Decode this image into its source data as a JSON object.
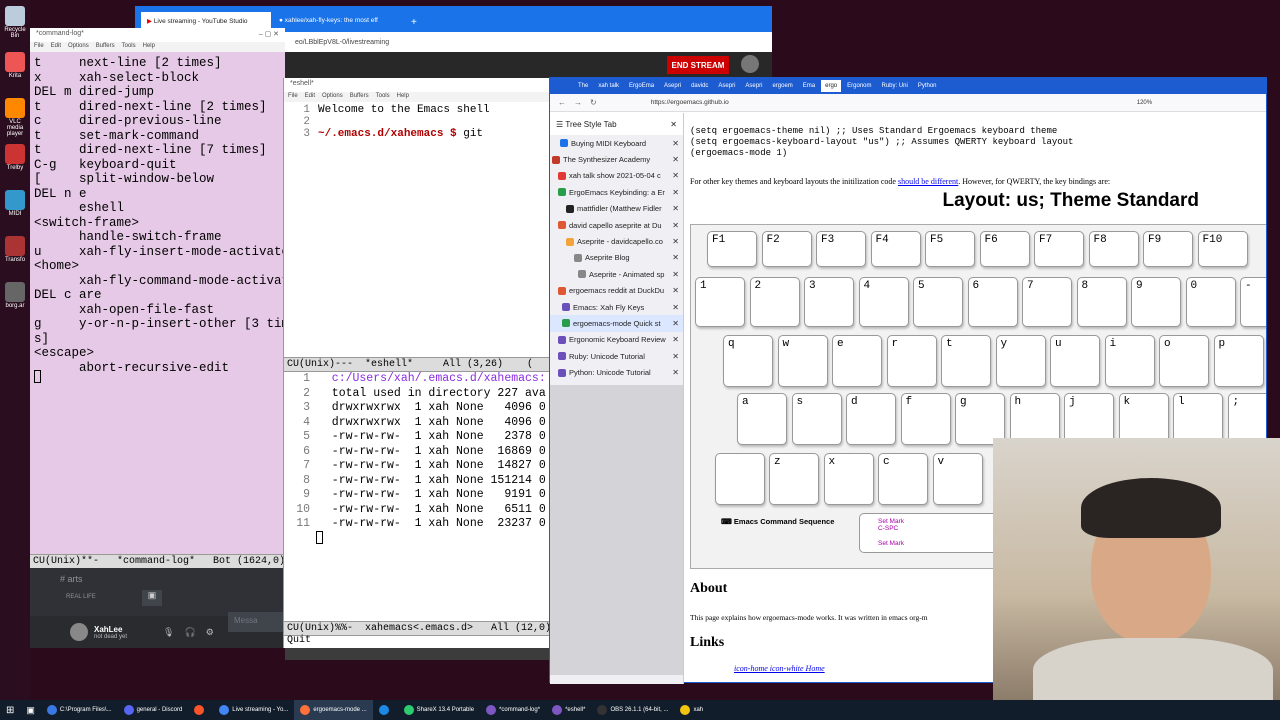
{
  "desktop": {
    "icons": [
      "Recycle Bin",
      "Krita",
      "VLC media player",
      "Trelby",
      "MIDI",
      "Transfo",
      "borg.ar"
    ]
  },
  "youtube_window": {
    "tabs": [
      {
        "label": "Live streaming - YouTube Studio"
      },
      {
        "label": "xahlee/xah-fly-keys: the most eff"
      }
    ],
    "url": "eo/LBblEpV8L-0/livestreaming",
    "end_stream": "END STREAM"
  },
  "cmdlog": {
    "title": "*command-log*",
    "menu": [
      "File",
      "Edit",
      "Options",
      "Buffers",
      "Tools",
      "Help"
    ],
    "lines": [
      "t     next-line [2 times]",
      "x     xah-select-block",
      "DEL m dired-jump",
      "t     dired-next-line [2 times]",
      "c     dired-previous-line",
      "t     set-mark-command",
      "t     dired-next-line [7 times]",
      "C-g   keyboard-quit",
      "[     split-window-below",
      "DEL n e",
      "      eshell",
      "<switch-frame>",
      "      handle-switch-frame",
      "u     xah-fly-insert-mode-activate",
      "<home>",
      "      xah-fly-command-mode-activate",
      "DEL c are",
      "      xah-open-file-fast",
      "g     y-or-n-p-insert-other [3 time",
      "s]",
      "<escape>",
      "      abort-recursive-edit"
    ],
    "modeline": "CU(Unix)**-   *command-log*   Bot (1624,0)"
  },
  "discord": {
    "channel": "arts",
    "category": "REAL LIFE",
    "user": "XahLee",
    "status": "not dead yet",
    "placeholder": "Messa"
  },
  "eshell": {
    "title": "*eshell*",
    "menu": [
      "File",
      "Edit",
      "Options",
      "Buffers",
      "Tools",
      "Help"
    ],
    "lines": [
      {
        "n": "1",
        "text": "Welcome to the Emacs shell"
      },
      {
        "n": "2",
        "text": ""
      },
      {
        "n": "3",
        "prompt": "~/.emacs.d/xahemacs $ ",
        "text": "git "
      }
    ],
    "modeline1": "CU(Unix)---  *eshell*     All (3,26)    (",
    "dired": [
      {
        "n": "1",
        "text": "  c:/Users/xah/.emacs.d/xahemacs:"
      },
      {
        "n": "2",
        "text": "  total used in directory 227 ava"
      },
      {
        "n": "3",
        "text": "  drwxrwxrwx  1 xah None   4096 0"
      },
      {
        "n": "4",
        "text": "  drwxrwxrwx  1 xah None   4096 0"
      },
      {
        "n": "5",
        "text": "  -rw-rw-rw-  1 xah None   2378 0"
      },
      {
        "n": "6",
        "text": "  -rw-rw-rw-  1 xah None  16869 0"
      },
      {
        "n": "7",
        "text": "  -rw-rw-rw-  1 xah None  14827 0"
      },
      {
        "n": "8",
        "text": "  -rw-rw-rw-  1 xah None 151214 0"
      },
      {
        "n": "9",
        "text": "  -rw-rw-rw-  1 xah None   9191 0"
      },
      {
        "n": "10",
        "text": "  -rw-rw-rw-  1 xah None   6511 0"
      },
      {
        "n": "11",
        "text": "  -rw-rw-rw-  1 xah None  23237 0"
      }
    ],
    "modeline2": "CU(Unix)%%-  xahemacs<.emacs.d>   All (12,0)",
    "minibuffer": "Quit"
  },
  "firefox": {
    "tabs": [
      "The",
      "xah talk",
      "ErgoEma",
      "Asepri",
      "davidc",
      "Asepri",
      "Asepri",
      "ergoem",
      "Ema",
      "ergo",
      "Ergonom",
      "Ruby: Uni",
      "Python"
    ],
    "url": "https://ergoemacs.github.io",
    "zoom": "120%",
    "sidebar_title": "Tree Style Tab",
    "tree": [
      {
        "label": "Buying MIDI Keyboard",
        "color": "#1a73e8"
      },
      {
        "label": "The Synthesizer Academy",
        "color": "#c0392b"
      },
      {
        "label": "xah talk show 2021-05-04 c",
        "color": "#e53935"
      },
      {
        "label": "ErgoEmacs Keybinding: a Er",
        "color": "#2a9d4a"
      },
      {
        "label": "mattfidler (Matthew Fidler",
        "color": "#222222"
      },
      {
        "label": "david capello aseprite at Du",
        "color": "#de5833"
      },
      {
        "label": "Aseprite - davidcapello.co",
        "color": "#f2a33a"
      },
      {
        "label": "Aseprite Blog",
        "color": "#888888"
      },
      {
        "label": "Aseprite - Animated sp",
        "color": "#888888"
      },
      {
        "label": "ergoemacs reddit at DuckDu",
        "color": "#de5833"
      },
      {
        "label": "Emacs: Xah Fly Keys",
        "color": "#6b4fbb"
      },
      {
        "label": "ergoemacs-mode Quick st",
        "color": "#2a9d4a"
      },
      {
        "label": "Ergonomic Keyboard Review",
        "color": "#6b4fbb"
      },
      {
        "label": "Ruby: Unicode Tutorial",
        "color": "#6b4fbb"
      },
      {
        "label": "Python: Unicode Tutorial",
        "color": "#6b4fbb"
      }
    ],
    "code1": "(setq ergoemacs-theme nil) ;; Uses Standard Ergoemacs keyboard theme",
    "code2": "(setq ergoemacs-keyboard-layout \"us\") ;; Assumes QWERTY keyboard layout",
    "code3": "(ergoemacs-mode 1)",
    "para_pre": "For other key themes and keyboard layouts the initilization code ",
    "para_link": "should be different",
    "para_post": ". However, for QWERTY, the key bindings are:",
    "layout_title": "Layout: us; Theme Standard",
    "fkeys": [
      "F1",
      "F2",
      "F3",
      "F4",
      "F5",
      "F6",
      "F7",
      "F8",
      "F9",
      "F10"
    ],
    "numkeys": [
      "1",
      "2",
      "3",
      "4",
      "5",
      "6",
      "7",
      "8",
      "9",
      "0",
      "-"
    ],
    "row_q": [
      "q",
      "w",
      "e",
      "r",
      "t",
      "y",
      "u",
      "i",
      "o",
      "p"
    ],
    "row_a": [
      "a",
      "s",
      "d",
      "f",
      "g",
      "h",
      "j",
      "k",
      "l",
      ";"
    ],
    "row_z": [
      "z",
      "x",
      "c",
      "v"
    ],
    "legend": "Emacs Command Sequence",
    "setmark": "Set Mark",
    "setmark_key": "C-SPC",
    "about": "About",
    "about_text": "This page explains how ergoemacs-mode works. It was written in emacs org-m",
    "links": "Links",
    "home_link": "icon-home icon-white Home"
  },
  "taskbar": [
    {
      "label": "C:\\Program Files\\...",
      "color": "#3b78e7"
    },
    {
      "label": "general - Discord",
      "color": "#5865f2"
    },
    {
      "label": "",
      "color": "#fb542b"
    },
    {
      "label": "Live streaming - Yo...",
      "color": "#4285f4"
    },
    {
      "label": "ergoemacs-mode ...",
      "color": "#ff7139"
    },
    {
      "label": "",
      "color": "#1e88e5"
    },
    {
      "label": "ShareX 13.4 Portable",
      "color": "#2ecc71"
    },
    {
      "label": "*command-log*",
      "color": "#7e57c2"
    },
    {
      "label": "*eshell*",
      "color": "#7e57c2"
    },
    {
      "label": "OBS 26.1.1 (64-bit, ...",
      "color": "#333333"
    },
    {
      "label": "xah",
      "color": "#f1c40f"
    }
  ]
}
